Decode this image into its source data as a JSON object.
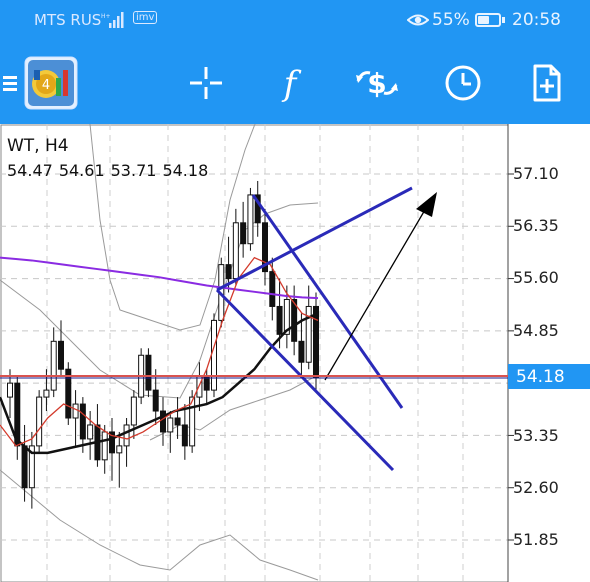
{
  "status_bar": {
    "carrier": "MTS RUS",
    "network": "H+",
    "imv": "imv",
    "battery_pct": "55%",
    "battery_level": 0.55,
    "time": "20:58"
  },
  "toolbar": {
    "icons": [
      "menu-icon",
      "app-logo-icon",
      "crosshair-icon",
      "indicators-icon",
      "trade-icon",
      "history-clock-icon",
      "new-order-icon"
    ],
    "indicators_glyph": "f"
  },
  "chart": {
    "symbol": "WT, H4",
    "ohlc": [
      "54.47",
      "54.61",
      "53.71",
      "54.18"
    ],
    "price_scale": [
      "57.10",
      "56.35",
      "55.60",
      "54.85",
      "53.35",
      "52.60",
      "51.85"
    ],
    "current_price": "54.18",
    "colors": {
      "accent": "#2196f3",
      "candles": "#000000",
      "trendlines": "#2a2ab8",
      "ma_red": "#d33a2c",
      "ma_purple": "#8a2be2",
      "bollinger": "#9a9a9a",
      "price_line": "#d9534f"
    }
  },
  "chart_data": {
    "type": "candlestick",
    "title": "",
    "symbol": "WT, H4",
    "ylim": [
      51.6,
      57.6
    ],
    "price_ticks": [
      57.1,
      56.35,
      55.6,
      54.85,
      53.35,
      52.6,
      51.85
    ],
    "current_price": 54.18,
    "candles": [
      [
        53.9,
        54.3,
        53.6,
        54.1
      ],
      [
        54.1,
        54.2,
        53.0,
        53.2
      ],
      [
        53.2,
        53.5,
        52.4,
        52.6
      ],
      [
        52.6,
        53.4,
        52.3,
        53.2
      ],
      [
        53.2,
        54.0,
        53.1,
        53.9
      ],
      [
        53.9,
        54.3,
        53.7,
        54.0
      ],
      [
        54.0,
        54.9,
        53.9,
        54.7
      ],
      [
        54.7,
        55.0,
        54.2,
        54.3
      ],
      [
        54.3,
        54.4,
        53.5,
        53.6
      ],
      [
        53.6,
        54.0,
        53.2,
        53.8
      ],
      [
        53.8,
        53.9,
        53.1,
        53.3
      ],
      [
        53.3,
        53.7,
        53.0,
        53.5
      ],
      [
        53.5,
        53.8,
        52.9,
        53.0
      ],
      [
        53.0,
        53.5,
        52.8,
        53.4
      ],
      [
        53.4,
        53.6,
        52.7,
        53.1
      ],
      [
        53.1,
        53.4,
        52.6,
        53.2
      ],
      [
        53.2,
        53.6,
        52.9,
        53.5
      ],
      [
        53.5,
        54.0,
        53.3,
        53.9
      ],
      [
        53.9,
        54.6,
        53.8,
        54.5
      ],
      [
        54.5,
        54.6,
        53.9,
        54.0
      ],
      [
        54.0,
        54.3,
        53.5,
        53.7
      ],
      [
        53.7,
        53.9,
        53.2,
        53.4
      ],
      [
        53.4,
        53.7,
        53.1,
        53.6
      ],
      [
        53.6,
        53.9,
        53.3,
        53.5
      ],
      [
        53.5,
        53.8,
        53.0,
        53.2
      ],
      [
        53.2,
        54.0,
        53.1,
        53.9
      ],
      [
        53.9,
        54.4,
        53.7,
        54.2
      ],
      [
        54.2,
        54.3,
        53.8,
        54.0
      ],
      [
        54.0,
        55.1,
        53.9,
        55.0
      ],
      [
        55.0,
        55.9,
        54.9,
        55.8
      ],
      [
        55.8,
        56.2,
        55.4,
        55.6
      ],
      [
        55.6,
        56.6,
        55.5,
        56.4
      ],
      [
        56.4,
        56.7,
        55.9,
        56.1
      ],
      [
        56.1,
        56.9,
        56.0,
        56.8
      ],
      [
        56.8,
        57.0,
        56.2,
        56.4
      ],
      [
        56.4,
        56.6,
        55.5,
        55.7
      ],
      [
        55.7,
        55.9,
        55.0,
        55.2
      ],
      [
        55.2,
        55.6,
        54.6,
        54.8
      ],
      [
        54.8,
        55.5,
        54.6,
        55.3
      ],
      [
        55.3,
        55.5,
        54.5,
        54.7
      ],
      [
        54.7,
        55.1,
        54.2,
        54.4
      ],
      [
        54.4,
        55.5,
        54.3,
        55.2
      ],
      [
        55.2,
        55.4,
        54.0,
        54.18
      ]
    ],
    "moving_averages": [
      {
        "color": "purple",
        "values": [
          55.9,
          55.88,
          55.86,
          55.83,
          55.8,
          55.77,
          55.74,
          55.71,
          55.68,
          55.65,
          55.62,
          55.58,
          55.54,
          55.5,
          55.47,
          55.44,
          55.41,
          55.38,
          55.35,
          55.33,
          55.32
        ]
      },
      {
        "color": "black",
        "values": [
          53.9,
          53.3,
          53.1,
          53.1,
          53.15,
          53.2,
          53.25,
          53.3,
          53.4,
          53.5,
          53.6,
          53.7,
          53.75,
          53.8,
          53.9,
          54.1,
          54.3,
          54.6,
          54.85,
          55.0,
          55.1
        ]
      },
      {
        "color": "red",
        "values": [
          53.5,
          53.2,
          53.3,
          53.6,
          53.8,
          53.7,
          53.5,
          53.35,
          53.3,
          53.4,
          53.55,
          53.7,
          53.8,
          54.3,
          55.0,
          55.6,
          55.9,
          55.8,
          55.4,
          55.1,
          55.0
        ]
      }
    ]
  }
}
